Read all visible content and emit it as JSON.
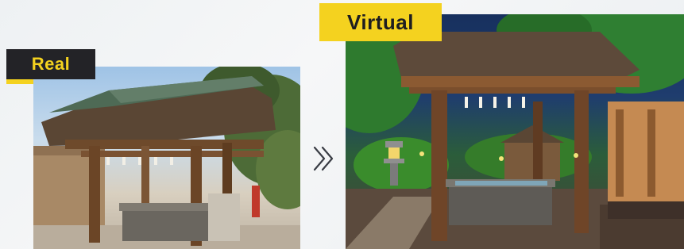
{
  "labels": {
    "real": "Real",
    "virtual": "Virtual"
  },
  "icons": {
    "transition": "double-chevron-right-icon"
  },
  "colors": {
    "accent_yellow": "#f4d21f",
    "label_dark": "#232327"
  }
}
